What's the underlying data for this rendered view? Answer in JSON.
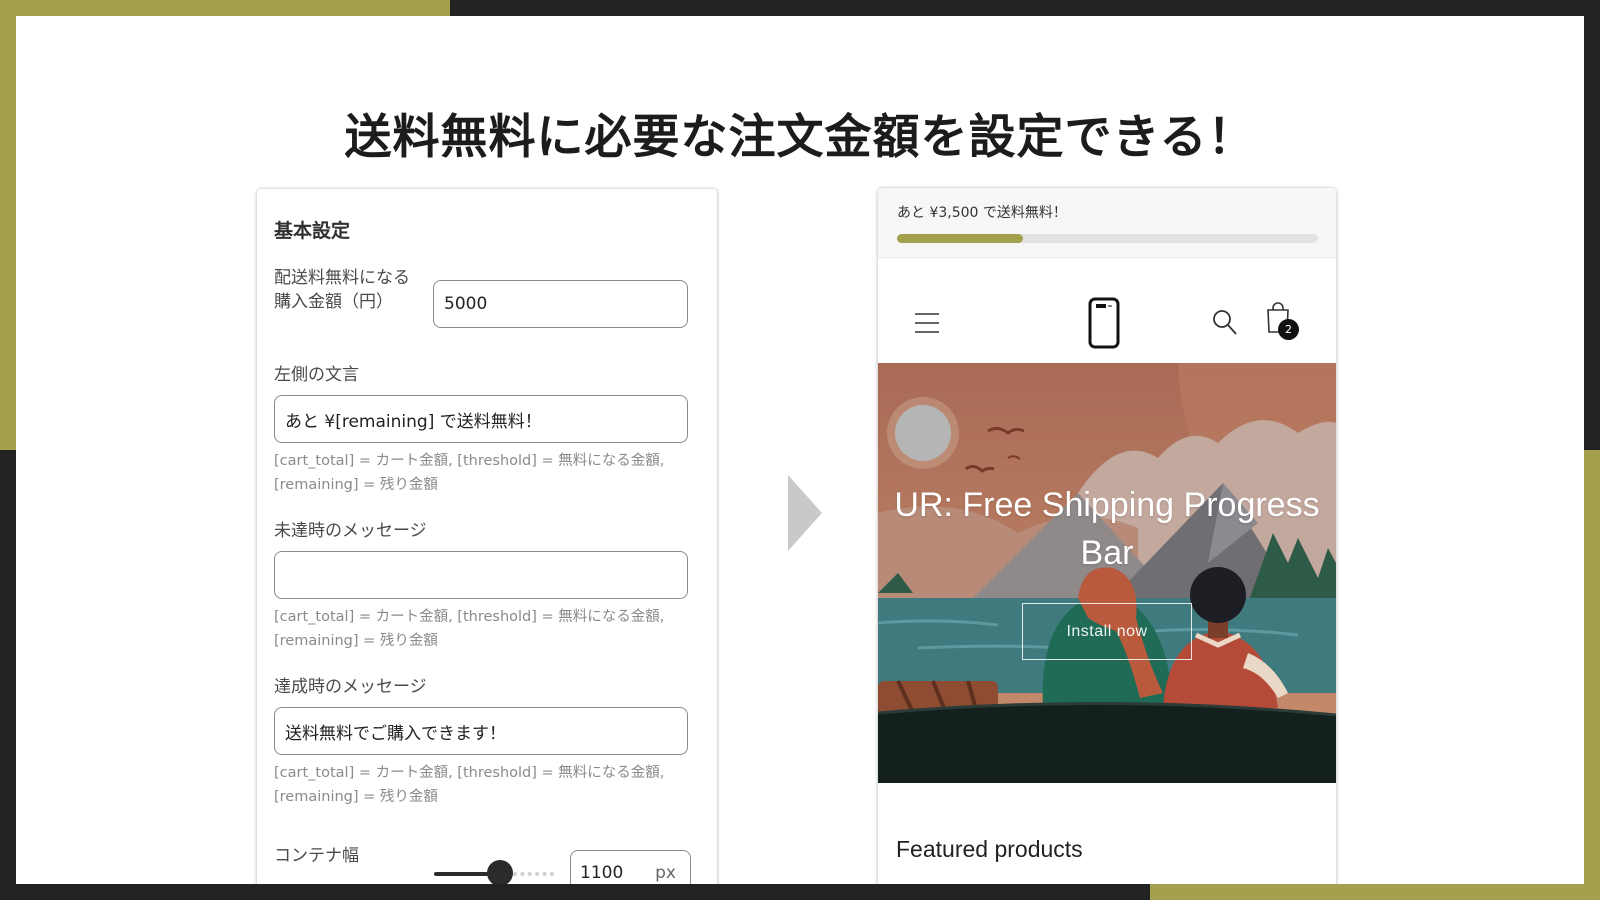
{
  "headline": "送料無料に必要な注文金額を設定できる！",
  "colors": {
    "accent": "#a3a04e",
    "dark_frame": "#222222",
    "badge": "#111111"
  },
  "settings": {
    "title": "基本設定",
    "threshold": {
      "label": "配送料無料になる\n購入金額（円）",
      "value": "5000"
    },
    "left_text": {
      "label": "左側の文言",
      "value": "あと ¥[remaining] で送料無料！"
    },
    "help_text": "[cart_total] = カート金額, [threshold] = 無料になる金額, [remaining] = 残り金額",
    "pending_message": {
      "label": "未達時のメッセージ",
      "value": ""
    },
    "achieved_message": {
      "label": "達成時のメッセージ",
      "value": "送料無料でご購入できます！"
    },
    "container_width": {
      "label": "コンテナ幅",
      "value": "1100",
      "unit": "px",
      "slider_fraction": 0.55
    }
  },
  "preview": {
    "announcement": "あと ¥3,500 で送料無料！",
    "progress_fraction": 0.3,
    "cart_count": "2",
    "icons": [
      "menu-icon",
      "phone-logo-icon",
      "search-icon",
      "cart-icon"
    ],
    "hero": {
      "title": "UR: Free Shipping Progress Bar",
      "button": "Install now"
    },
    "featured_heading": "Featured products"
  }
}
